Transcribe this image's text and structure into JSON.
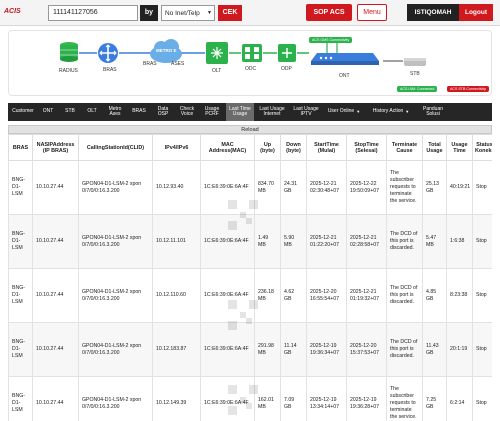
{
  "header": {
    "logo": "ACIS",
    "search_value": "111141127056",
    "by_label": "by",
    "select_value": "No Inet/Telp",
    "cek_label": "CEK",
    "sop_label": "SOP ACS",
    "menu_label": "Menu",
    "user_label": "ISTIQOMAH",
    "logout_label": "Logout"
  },
  "topology": {
    "radius": "RADIUS",
    "bras": "BRAS",
    "bras_prefix": "BRAS",
    "cloud": "METRO E",
    "metro_suffix": "ASES",
    "olt": "OLT",
    "odc": "ODC",
    "odp": "ODP",
    "ont": "ONT",
    "stb": "STB",
    "status_green": "ACS UIM: Connected",
    "status_red": "ACS STB Connectivity",
    "status_green2": "ACS OMS Connectivity",
    "colors": {
      "green": "#2bb24c",
      "blue": "#3b7ddd",
      "red": "#d0191f"
    }
  },
  "nav": {
    "items": [
      "Customer",
      "ONT",
      "STB",
      "OLT",
      "Metro Ases",
      "BRAS",
      "Data OSP",
      "Check Voice",
      "Usage PCRF",
      "Last Time Usage",
      "Last Usage Internet",
      "Last Usage IPTV",
      "User Online",
      "History Action",
      "Panduan Solusi"
    ],
    "active_index": 9
  },
  "table": {
    "reload_label": "Reload",
    "headers": [
      "BRAS",
      "NASIPAddress (IP BRAS)",
      "CallingStationId(CLID)",
      "IPv4/IPv6",
      "MAC Address(MAC)",
      "Up (byte)",
      "Down (byte)",
      "StartTime (Mulai)",
      "StopTime (Selesai)",
      "Terminate Cause",
      "Total Usage",
      "Usage Time",
      "Status Koneksi"
    ],
    "rows": [
      [
        "BNG-D1-LSM",
        "10.10.27.44",
        "GPON04-D1-LSM-2 xpon 0/7/0/0:16.3.200",
        "10.12.93.40",
        "1C:E6:39:0E:6A:4F",
        "834.70 MB",
        "24.31 GB",
        "2025-12-21 02:30:48+07",
        "2025-12-22 19:50:09+07",
        "The subscriber requests to terminate the service.",
        "25.13 GB",
        "40:19:21",
        "Stop"
      ],
      [
        "BNG-D1-LSM",
        "10.10.27.44",
        "GPON04-D1-LSM-2 xpon 0/7/0/0:16.3.200",
        "10.12.11.101",
        "1C:E6:39:0E:6A:4F",
        "1.49 MB",
        "5.90 MB",
        "2025-12-21 01:22:20+07",
        "2025-12-21 02:28:58+07",
        "The DCD of this port is discarded.",
        "5.47 MB",
        "1:6:38",
        "Stop"
      ],
      [
        "BNG-D1-LSM",
        "10.10.27.44",
        "GPON04-D1-LSM-2 xpon 0/7/0/0:16.3.200",
        "10.12.110.60",
        "1C:E6:39:0E:6A:4F",
        "236.18 MB",
        "4.62 GB",
        "2025-12-20 16:55:54+07",
        "2025-12-21 01:19:32+07",
        "The DCD of this port is discarded.",
        "4.85 GB",
        "8:23:38",
        "Stop"
      ],
      [
        "BNG-D1-LSM",
        "10.10.27.44",
        "GPON04-D1-LSM-2 xpon 0/7/0/0:16.3.200",
        "10.12.183.87",
        "1C:E6:39:0E:6A:4F",
        "291.98 MB",
        "11.14 GB",
        "2025-12-19 19:36:34+07",
        "2025-12-20 15:37:53+07",
        "The DCD of this port is discarded.",
        "11.43 GB",
        "20:1:19",
        "Stop"
      ],
      [
        "BNG-D1-LSM",
        "10.10.27.44",
        "GPON04-D1-LSM-2 xpon 0/7/0/0:16.3.200",
        "10.12.149.39",
        "1C:E6:39:0E:6A:4F",
        "162.01 MB",
        "7.09 GB",
        "2025-12-19 13:34:14+07",
        "2025-12-19 19:36:28+07",
        "The subscriber requests to terminate the service.",
        "7.25 GB",
        "6:2:14",
        "Stop"
      ]
    ]
  }
}
